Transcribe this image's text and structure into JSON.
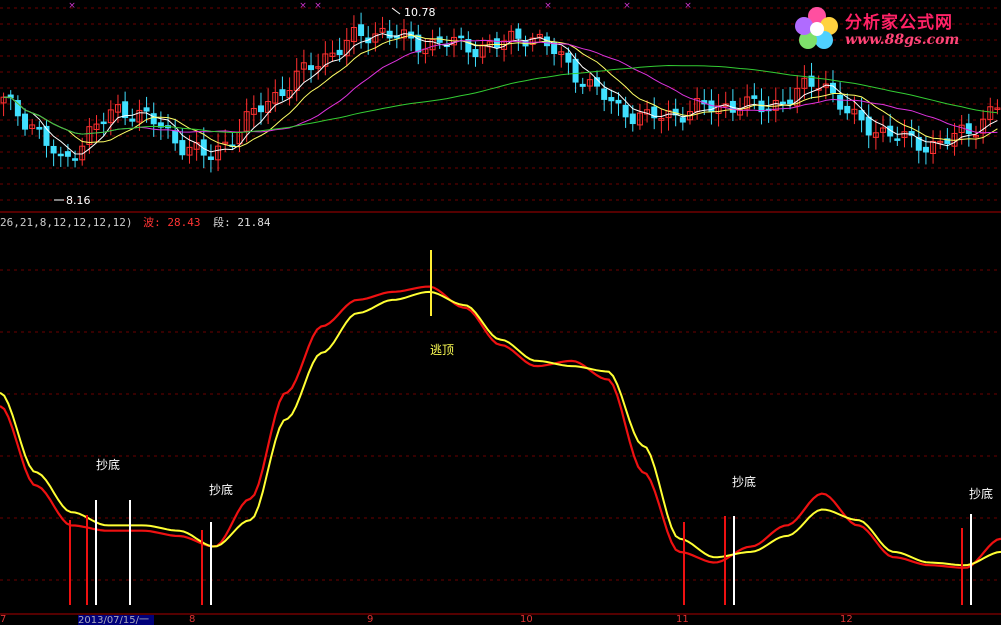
{
  "logo": {
    "title": "分析家公式网",
    "url": "www.88gs.com",
    "icon": "flower-icon",
    "title_color": "#ff2266"
  },
  "price_panel": {
    "high_marker": "10.78",
    "low_marker": "8.16"
  },
  "indicator_info": {
    "params": "26,21,8,12,12,12,12)",
    "wave_label": "波:",
    "wave_value": "28.43",
    "segment_label": "段:",
    "segment_value": "21.84",
    "params_color": "#cccccc",
    "wave_color": "#ff3333",
    "segment_color": "#dddddd"
  },
  "signals": {
    "buy_1": "抄底",
    "buy_2": "抄底",
    "sell": "逃顶",
    "buy_3": "抄底",
    "buy_4": "抄底"
  },
  "x_axis": {
    "current_date": "2013/07/15/一",
    "ticks": [
      "7",
      "8",
      "9",
      "10",
      "11",
      "12"
    ]
  },
  "colors": {
    "background": "#000000",
    "grid": "#6b0000",
    "up_candle": "#ff3030",
    "down_candle": "#40e0ff",
    "ma_short": "#ffffff",
    "ma_mid": "#ffff66",
    "ma_long": "#dd33dd",
    "ma_longest": "#33cc33",
    "wave_line": "#ee1111",
    "segment_line": "#ffff33"
  },
  "chart_data": [
    {
      "type": "candlestick",
      "title": "",
      "price_range": [
        7.7,
        11.1
      ],
      "markers": {
        "high": 10.78,
        "low": 8.16
      },
      "close_path": [
        9.5,
        9.1,
        8.4,
        9.0,
        9.4,
        9.2,
        8.8,
        8.5,
        9.0,
        9.5,
        9.9,
        10.3,
        10.6,
        10.75,
        10.5,
        10.55,
        10.45,
        10.5,
        10.7,
        10.3,
        9.8,
        9.4,
        9.2,
        9.3,
        9.4,
        9.45,
        9.4,
        9.6,
        9.9,
        9.2,
        9.0,
        8.8,
        8.75,
        9.0,
        9.4
      ]
    },
    {
      "type": "line",
      "title": "",
      "series": [
        {
          "name": "波",
          "last_value": 28.43,
          "values": [
            75,
            45,
            30,
            28,
            28,
            26,
            22,
            40,
            80,
            105,
            115,
            118,
            120,
            112,
            98,
            90,
            92,
            85,
            50,
            20,
            16,
            22,
            30,
            42,
            30,
            18,
            15,
            14,
            25
          ]
        },
        {
          "name": "段",
          "last_value": 21.84,
          "values": [
            80,
            50,
            35,
            30,
            30,
            28,
            22,
            32,
            70,
            95,
            110,
            115,
            118,
            113,
            100,
            92,
            90,
            88,
            60,
            25,
            18,
            20,
            26,
            36,
            32,
            20,
            16,
            15,
            20
          ]
        }
      ],
      "annotations": [
        "抄底",
        "抄底",
        "逃顶",
        "抄底",
        "抄底"
      ]
    }
  ]
}
